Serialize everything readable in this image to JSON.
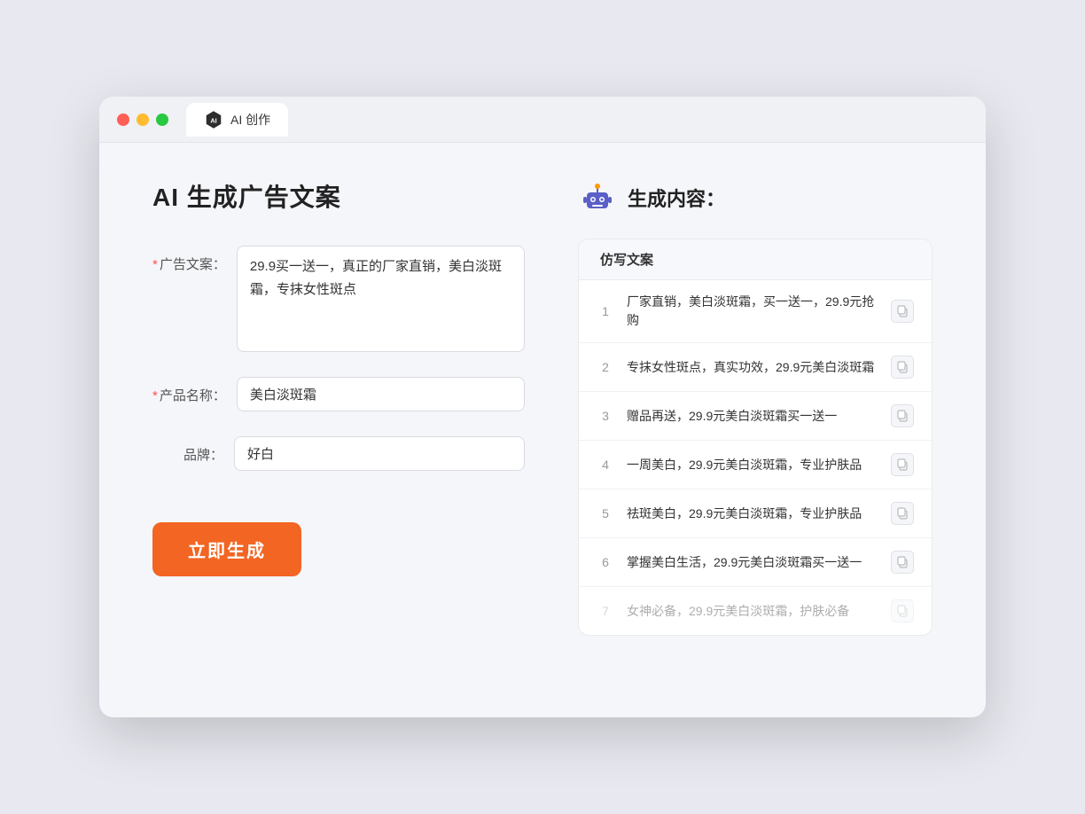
{
  "window": {
    "title": "AI 创作"
  },
  "page": {
    "title": "AI 生成广告文案"
  },
  "form": {
    "ad_copy_label": "广告文案：",
    "ad_copy_required": "*",
    "ad_copy_value": "29.9买一送一，真正的厂家直销，美白淡斑霜，专抹女性斑点",
    "product_name_label": "产品名称：",
    "product_name_required": "*",
    "product_name_value": "美白淡斑霜",
    "brand_label": "品牌：",
    "brand_value": "好白",
    "generate_btn": "立即生成"
  },
  "result": {
    "title": "生成内容：",
    "table_header": "仿写文案",
    "items": [
      {
        "num": "1",
        "text": "厂家直销，美白淡斑霜，买一送一，29.9元抢购",
        "faded": false
      },
      {
        "num": "2",
        "text": "专抹女性斑点，真实功效，29.9元美白淡斑霜",
        "faded": false
      },
      {
        "num": "3",
        "text": "赠品再送，29.9元美白淡斑霜买一送一",
        "faded": false
      },
      {
        "num": "4",
        "text": "一周美白，29.9元美白淡斑霜，专业护肤品",
        "faded": false
      },
      {
        "num": "5",
        "text": "祛斑美白，29.9元美白淡斑霜，专业护肤品",
        "faded": false
      },
      {
        "num": "6",
        "text": "掌握美白生活，29.9元美白淡斑霜买一送一",
        "faded": false
      },
      {
        "num": "7",
        "text": "女神必备，29.9元美白淡斑霜，护肤必备",
        "faded": true
      }
    ]
  },
  "icons": {
    "copy": "⧉",
    "robot": "🤖"
  }
}
